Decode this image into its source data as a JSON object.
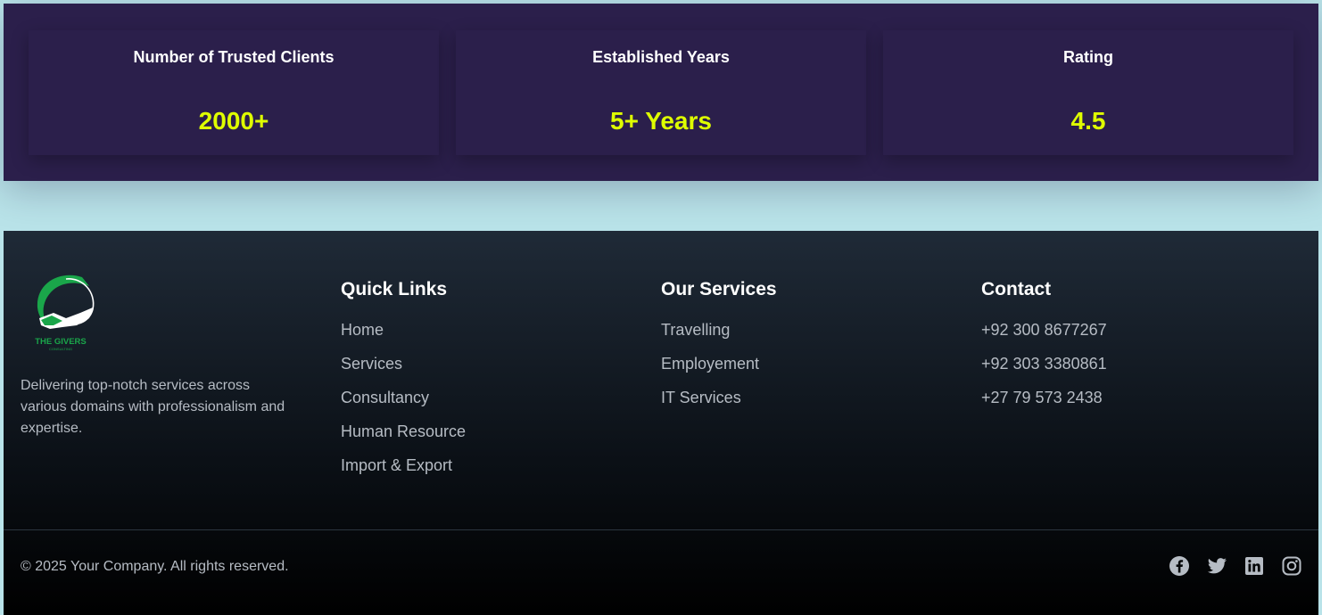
{
  "colors": {
    "accent": "#dfff00",
    "stats_bg": "#2b1f4b",
    "page_bg": "#b9e3e9",
    "footer_text": "#b6bcc4",
    "logo_green": "#1aa64a"
  },
  "stats": [
    {
      "label": "Number of Trusted Clients",
      "value": "2000+"
    },
    {
      "label": "Established Years",
      "value": "5+ Years"
    },
    {
      "label": "Rating",
      "value": "4.5"
    }
  ],
  "footer": {
    "logo": {
      "name": "THE GIVERS",
      "tagline": "CONSULTING",
      "icon": "handshake-logo-icon"
    },
    "about": "Delivering top-notch services across various domains with professionalism and expertise.",
    "quick_links": {
      "title": "Quick Links",
      "items": [
        "Home",
        "Services",
        "Consultancy",
        "Human Resource",
        "Import & Export"
      ]
    },
    "services": {
      "title": "Our Services",
      "items": [
        "Travelling",
        "Employement",
        "IT Services"
      ]
    },
    "contact": {
      "title": "Contact",
      "items": [
        "+92 300 8677267",
        "+92 303 3380861",
        "+27 79 573 2438"
      ]
    },
    "copyright": "© 2025 Your Company. All rights reserved.",
    "socials": [
      "facebook-icon",
      "twitter-icon",
      "linkedin-icon",
      "instagram-icon"
    ]
  }
}
